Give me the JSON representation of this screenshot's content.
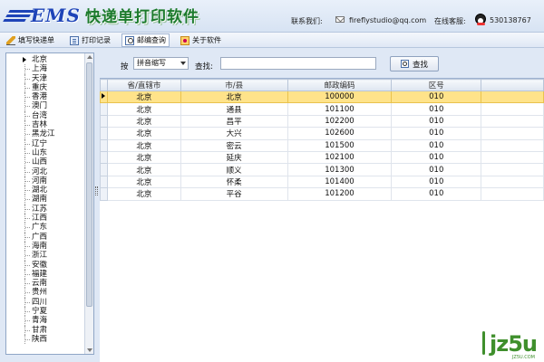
{
  "header": {
    "title": "快递单打印软件",
    "logo_text": "EMS",
    "contact_label": "联系我们:",
    "email": "fireflystudio@qq.com",
    "service_label": "在线客服:",
    "qq": "530138767"
  },
  "toolbar": {
    "items": [
      {
        "label": "填写快递单",
        "icon": "pencil-icon",
        "active": false
      },
      {
        "label": "打印记录",
        "icon": "document-icon",
        "active": false
      },
      {
        "label": "邮编查询",
        "icon": "search-page-icon",
        "active": true
      },
      {
        "label": "关于软件",
        "icon": "about-icon",
        "active": false
      }
    ]
  },
  "provinces": [
    "北京",
    "上海",
    "天津",
    "重庆",
    "香港",
    "澳门",
    "台湾",
    "吉林",
    "黑龙江",
    "辽宁",
    "山东",
    "山西",
    "河北",
    "河南",
    "湖北",
    "湖南",
    "江苏",
    "江西",
    "广东",
    "广西",
    "海南",
    "浙江",
    "安徽",
    "福建",
    "云南",
    "贵州",
    "四川",
    "宁夏",
    "青海",
    "甘肃",
    "陕西"
  ],
  "search": {
    "by_label": "按",
    "mode_value": "拼音缩写",
    "find_label": "查找:",
    "query_value": "",
    "button_label": "查找"
  },
  "grid": {
    "columns": [
      "省/直辖市",
      "市/县",
      "邮政编码",
      "区号"
    ],
    "rows": [
      [
        "北京",
        "北京",
        "100000",
        "010"
      ],
      [
        "北京",
        "通县",
        "101100",
        "010"
      ],
      [
        "北京",
        "昌平",
        "102200",
        "010"
      ],
      [
        "北京",
        "大兴",
        "102600",
        "010"
      ],
      [
        "北京",
        "密云",
        "101500",
        "010"
      ],
      [
        "北京",
        "延庆",
        "102100",
        "010"
      ],
      [
        "北京",
        "顺义",
        "101300",
        "010"
      ],
      [
        "北京",
        "怀柔",
        "101400",
        "010"
      ],
      [
        "北京",
        "平谷",
        "101200",
        "010"
      ]
    ],
    "selected_row": 0
  },
  "watermark": {
    "text": "jz5u",
    "sub": "JZ5U.COM"
  },
  "colors": {
    "accent": "#1e44b8",
    "title_green": "#1b7a2b",
    "selection": "#ffe38a",
    "watermark": "#3f8f2c"
  }
}
